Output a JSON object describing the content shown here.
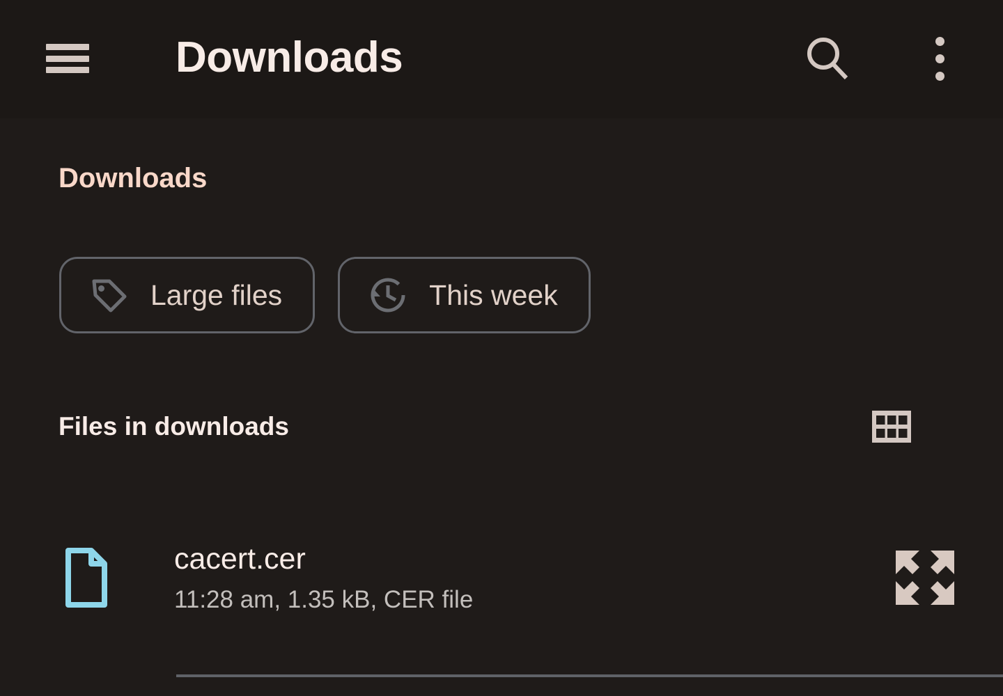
{
  "appbar": {
    "menu_icon": "hamburger-menu-icon",
    "title": "Downloads",
    "search_icon": "search-icon",
    "overflow_icon": "more-vertical-icon"
  },
  "section": {
    "heading": "Downloads"
  },
  "filters": {
    "chips": [
      {
        "label": "Large files",
        "icon": "tag-icon"
      },
      {
        "label": "This week",
        "icon": "history-clock-icon"
      }
    ]
  },
  "files_section": {
    "header_label": "Files in downloads",
    "view_toggle_icon": "grid-view-icon",
    "items": [
      {
        "name": "cacert.cer",
        "meta": "11:28 am, 1.35 kB, CER file",
        "icon": "document-file-icon",
        "action_icon": "expand-arrows-icon"
      }
    ]
  },
  "colors": {
    "background": "#1f1b19",
    "appbar_background": "#1c1816",
    "primary_text": "#f8ece7",
    "accent_heading": "#f9d8c9",
    "secondary_text": "#c3bfbc",
    "chip_border": "#62646a",
    "chip_icon": "#6c6e73",
    "file_icon": "#8ed6ea",
    "divider": "#5f6267",
    "icon_light": "#d4c8c2"
  }
}
